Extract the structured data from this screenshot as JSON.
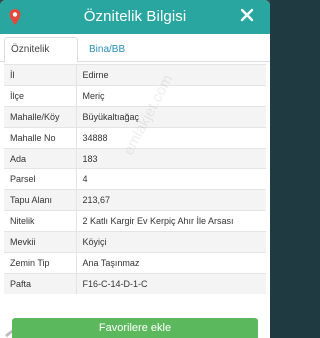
{
  "dialog": {
    "title": "Öznitelik Bilgisi",
    "tabs": [
      {
        "label": "Öznitelik Bilgisi",
        "active": true
      },
      {
        "label": "Bina/BB Listesi",
        "active": false
      }
    ]
  },
  "attributes": [
    {
      "key": "İl",
      "value": "Edirne"
    },
    {
      "key": "İlçe",
      "value": "Meriç"
    },
    {
      "key": "Mahalle/Köy",
      "value": "Büyükaltıağaç"
    },
    {
      "key": "Mahalle No",
      "value": "34888"
    },
    {
      "key": "Ada",
      "value": "183"
    },
    {
      "key": "Parsel",
      "value": "4"
    },
    {
      "key": "Tapu Alanı",
      "value": "213,67"
    },
    {
      "key": "Nitelik",
      "value": "2 Katlı Kargir Ev Kerpiç Ahır İle Arsası"
    },
    {
      "key": "Mevkii",
      "value": "Köyiçi"
    },
    {
      "key": "Zemin Tip",
      "value": "Ana Taşınmaz"
    },
    {
      "key": "Pafta",
      "value": "F16-C-14-D-1-C"
    }
  ],
  "watermark": "emlakjet.com",
  "footer": {
    "favorite_label": "Favorilere ekle"
  },
  "colors": {
    "header": "#2aa6a0",
    "tab_link": "#2a8fb8",
    "favorite_button": "#5cb85c"
  },
  "icons": {
    "header_left": "map-pin-icon",
    "header_right": "close-icon",
    "corner": "house-roof-logo"
  }
}
